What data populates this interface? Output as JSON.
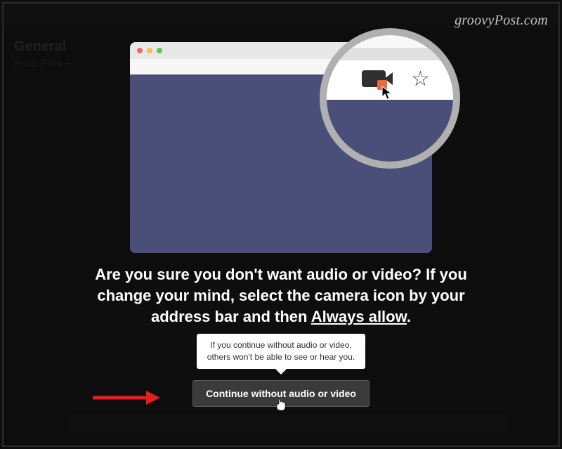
{
  "watermark": "groovyPost.com",
  "background": {
    "channel": "General",
    "tabs": "Posts  Files  +"
  },
  "dialog": {
    "heading_a": "Are you sure you don't want audio or video? If you change your mind, select the camera icon by your address bar and then ",
    "heading_underline": "Always allow",
    "heading_tail": ".",
    "tooltip": "If you continue without audio or video, others won't be able to see or hear you.",
    "continue_label": "Continue without audio or video"
  }
}
